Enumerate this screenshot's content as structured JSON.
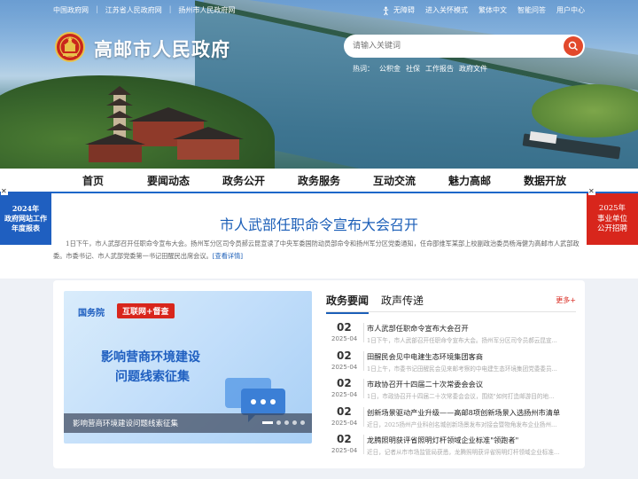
{
  "topbar": {
    "links": [
      "中国政府网",
      "江苏省人民政府网",
      "扬州市人民政府网"
    ],
    "accessibility": "无障碍",
    "elder_mode": "进入关怀模式",
    "traditional": "繁体中文",
    "qa": "智能问答",
    "user_center": "用户中心"
  },
  "site": {
    "title": "高邮市人民政府"
  },
  "search": {
    "placeholder": "请输入关键词",
    "hot_label": "热词：",
    "hotwords": [
      "公积金",
      "社保",
      "工作报告",
      "政府文件"
    ]
  },
  "nav": [
    "首页",
    "要闻动态",
    "政务公开",
    "政务服务",
    "互动交流",
    "魅力高邮",
    "数据开放"
  ],
  "headline": {
    "title": "市人武部任职命令宣布大会召开",
    "summary": "1日下午，市人武部召开任职命令宣布大会。扬州军分区司令员郝云昆宣读了中央军委国防动员部命令和扬州军分区党委通知，任命邵维军某部上校副政治委员杨海健为高邮市人武部政委。市委书记、市人武部党委第一书记田醒民出席会议。",
    "more_link": "[查看详情]"
  },
  "float_left": {
    "line1": "2024年",
    "line2": "政府网站工作",
    "line3": "年度报表"
  },
  "float_right": {
    "line1": "2025年",
    "line2": "事业单位",
    "line3": "公开招聘"
  },
  "promo": {
    "tag": "国务院",
    "red_tag": "互联网+督查",
    "title_line1": "影响营商环境建设",
    "title_line2": "问题线索征集",
    "caption": "影响营商环境建设问题线索征集"
  },
  "news": {
    "tab_active": "政务要闻",
    "tab_inactive": "政声传递",
    "more": "更多+",
    "items": [
      {
        "day": "02",
        "ym": "2025-04",
        "title": "市人武部任职命令宣布大会召开",
        "snippet": "1日下午，市人武部召开任职命令宣布大会。扬州军分区司令员郝云昆宣..."
      },
      {
        "day": "02",
        "ym": "2025-04",
        "title": "田醒民会见中电建生态环境集团客商",
        "snippet": "1日上午，市委书记田醒民会见来邮考察的中电建生态环境集团党委委员..."
      },
      {
        "day": "02",
        "ym": "2025-04",
        "title": "市政协召开十四届二十次常委会会议",
        "snippet": "1日，市政协召开十四届二十次常委会会议，围绕\"如何打造邮游目的地..."
      },
      {
        "day": "02",
        "ym": "2025-04",
        "title": "创新场景驱动产业升级——高邮8项创新场景入选扬州市清单",
        "snippet": "近日，2025扬州产业科创名城创新场景发布对接会暨物角发布企业扬州..."
      },
      {
        "day": "02",
        "ym": "2025-04",
        "title": "龙腾照明获评省照明灯杆领域企业标准\"领跑者\"",
        "snippet": "近日，记者从市市场监管局获悉，龙腾照明获评省照明灯杆领域企业标准..."
      }
    ]
  },
  "colors": {
    "brand_blue": "#1c5fb8",
    "accent_red": "#d8261c"
  }
}
